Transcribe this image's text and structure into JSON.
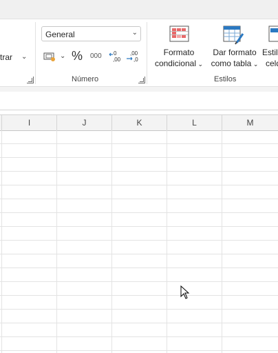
{
  "ribbon": {
    "filter_label": "trar",
    "number": {
      "format_value": "General",
      "group_label": "Número",
      "percent_symbol": "%",
      "thousands_symbol": "000"
    },
    "styles": {
      "group_label": "Estilos",
      "conditional_line1": "Formato",
      "conditional_line2": "condicional",
      "table_line1": "Dar formato",
      "table_line2": "como tabla",
      "cell_line1": "Estil",
      "cell_line2": "celd"
    }
  },
  "sheet": {
    "columns": [
      "I",
      "J",
      "K",
      "L",
      "M"
    ]
  },
  "icons": {
    "chevron": "chevron-down-icon",
    "launcher": "dialog-launcher-icon",
    "accounting": "accounting-format-icon",
    "increase_decimal": "increase-decimal-icon",
    "decrease_decimal": "decrease-decimal-icon",
    "conditional_format": "conditional-format-icon",
    "format_table": "format-as-table-icon",
    "cell_styles": "cell-styles-icon",
    "cursor": "mouse-pointer-icon"
  }
}
